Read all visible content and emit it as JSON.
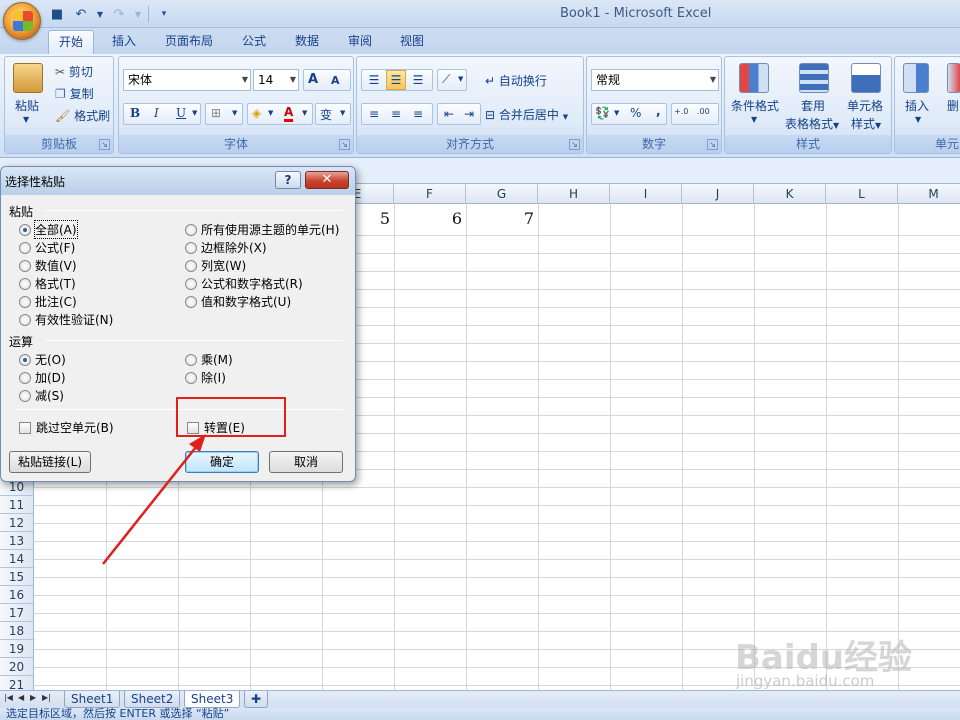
{
  "window": {
    "title": "Book1 - Microsoft Excel"
  },
  "tabs": [
    "开始",
    "插入",
    "页面布局",
    "公式",
    "数据",
    "审阅",
    "视图"
  ],
  "ribbon": {
    "clipboard": {
      "label": "剪贴板",
      "paste": "粘贴",
      "cut": "剪切",
      "copy": "复制",
      "format_painter": "格式刷"
    },
    "font": {
      "label": "字体",
      "font_name": "宋体",
      "font_size": "14",
      "grow": "A",
      "shrink": "A",
      "bold": "B",
      "italic": "I",
      "underline": "U",
      "font_color": "A",
      "phonetic": "变"
    },
    "alignment": {
      "label": "对齐方式",
      "wrap_text": "自动换行",
      "merge_center": "合并后居中"
    },
    "number": {
      "label": "数字",
      "format": "常规",
      "percent": "%",
      "comma": ",",
      "inc_decimal": "←.00\n.00",
      "dec_decimal": ".00\n→.0"
    },
    "styles": {
      "label": "样式",
      "conditional": "条件格式",
      "table_format_1": "套用",
      "table_format_2": "表格格式",
      "cell_styles_1": "单元格",
      "cell_styles_2": "样式"
    },
    "cells": {
      "label": "单元",
      "insert": "插入",
      "delete": "删"
    }
  },
  "grid": {
    "columns": [
      "E",
      "F",
      "G",
      "H",
      "I",
      "J",
      "K",
      "L",
      "M"
    ],
    "rows": [
      "10",
      "11",
      "12",
      "13",
      "14",
      "15",
      "16",
      "17",
      "18",
      "19",
      "20",
      "21"
    ],
    "values": [
      {
        "col": "E",
        "value": "5"
      },
      {
        "col": "F",
        "value": "6"
      },
      {
        "col": "G",
        "value": "7"
      }
    ]
  },
  "sheets": [
    "Sheet1",
    "Sheet2",
    "Sheet3"
  ],
  "status": "选定目标区域，然后按 ENTER 或选择 “粘贴”",
  "watermark": {
    "main": "Baidu经验",
    "sub": "jingyan.baidu.com"
  },
  "dialog": {
    "title": "选择性粘贴",
    "help": "?",
    "close": "✕",
    "paste_section": "粘贴",
    "paste_left": [
      "全部(A)",
      "公式(F)",
      "数值(V)",
      "格式(T)",
      "批注(C)",
      "有效性验证(N)"
    ],
    "paste_right": [
      "所有使用源主题的单元(H)",
      "边框除外(X)",
      "列宽(W)",
      "公式和数字格式(R)",
      "值和数字格式(U)"
    ],
    "operation_section": "运算",
    "op_left": [
      "无(O)",
      "加(D)",
      "减(S)"
    ],
    "op_right": [
      "乘(M)",
      "除(I)"
    ],
    "skip_blanks": "跳过空单元(B)",
    "transpose": "转置(E)",
    "paste_link": "粘贴链接(L)",
    "ok": "确定",
    "cancel": "取消"
  }
}
